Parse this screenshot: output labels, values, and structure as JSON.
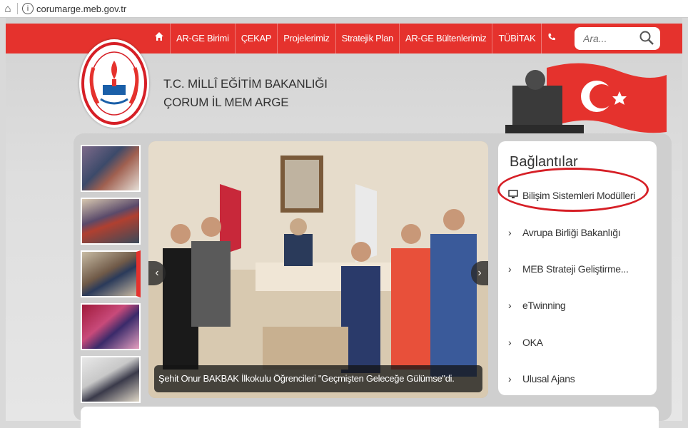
{
  "browser": {
    "url": "corumarge.meb.gov.tr"
  },
  "nav": {
    "items": [
      "AR-GE Birimi",
      "ÇEKAP",
      "Projelerimiz",
      "Stratejik Plan",
      "AR-GE Bültenlerimiz",
      "TÜBİTAK"
    ],
    "brand_color": "#e5322d"
  },
  "search": {
    "placeholder": "Ara..."
  },
  "header": {
    "line1": "T.C. MİLLÎ EĞİTİM BAKANLIĞI",
    "line2": "ÇORUM İL MEM ARGE"
  },
  "logo": {
    "ring_text": "T.C. MİLLÎ EĞİTİM BAKANLIĞI"
  },
  "slider": {
    "caption": "Şehit Onur BAKBAK İlkokulu Öğrencileri \"Geçmişten Geleceğe Gülümse\"di.",
    "thumbnail_count": 5,
    "active_thumbnail": 3
  },
  "links": {
    "title": "Bağlantılar",
    "items": [
      {
        "label": "Bilişim Sistemleri Modülleri",
        "icon": "monitor-icon"
      },
      {
        "label": "Avrupa Birliği Bakanlığı",
        "icon": "chevron-right-icon"
      },
      {
        "label": "MEB Strateji Geliştirme...",
        "icon": "chevron-right-icon"
      },
      {
        "label": "eTwinning",
        "icon": "chevron-right-icon"
      },
      {
        "label": "OKA",
        "icon": "chevron-right-icon"
      },
      {
        "label": "Ulusal Ajans",
        "icon": "chevron-right-icon"
      }
    ],
    "highlight_color": "#d61f26"
  }
}
